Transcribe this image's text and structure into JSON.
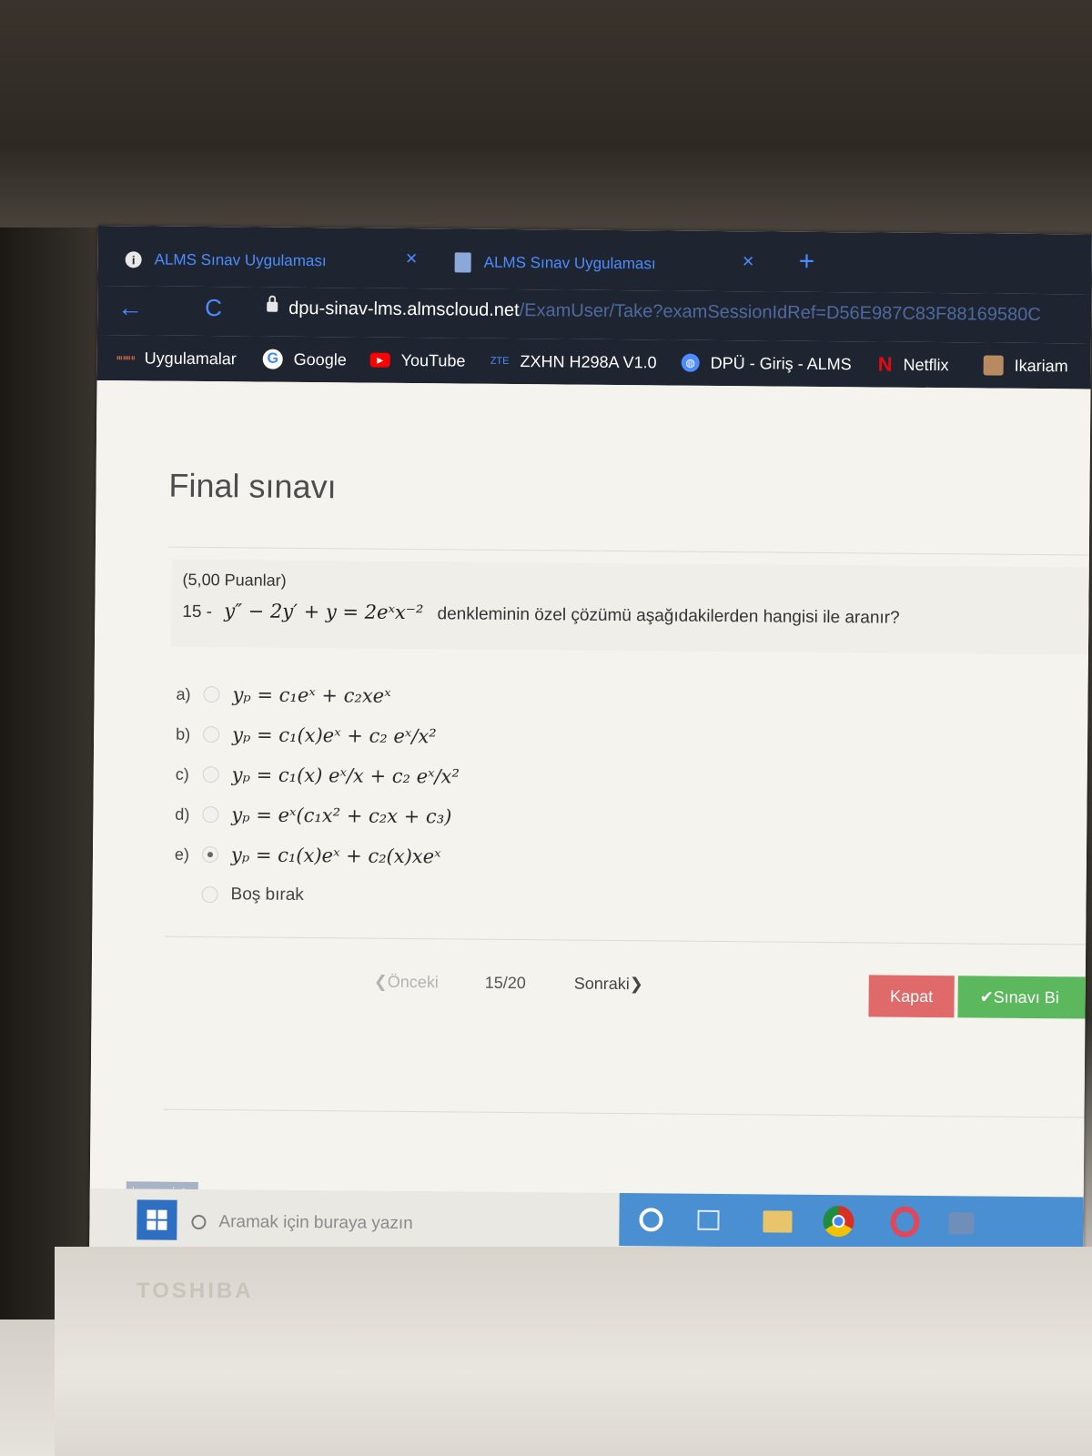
{
  "browser": {
    "tabs": [
      {
        "title": "ALMS Sınav Uygulaması",
        "icon": "info-icon"
      },
      {
        "title": "ALMS Sınav Uygulaması",
        "icon": "document-icon"
      }
    ],
    "close_glyph": "×",
    "new_tab_glyph": "+",
    "back_glyph": "←",
    "reload_glyph": "C",
    "url_host": "dpu-sinav-lms.almscloud.net",
    "url_path": "/ExamUser/Take?examSessionIdRef=D56E987C83F88169580C",
    "bookmarks": [
      {
        "label": "Uygulamalar",
        "icon": "apps-icon"
      },
      {
        "label": "Google",
        "icon": "google-icon"
      },
      {
        "label": "YouTube",
        "icon": "youtube-icon"
      },
      {
        "label": "ZXHN H298A V1.0",
        "icon": "zte-icon",
        "icon_text": "ZTE"
      },
      {
        "label": "DPÜ - Giriş - ALMS",
        "icon": "globe-icon"
      },
      {
        "label": "Netflix",
        "icon": "netflix-icon",
        "icon_text": "N"
      },
      {
        "label": "Ikariam",
        "icon": "ikariam-icon"
      }
    ]
  },
  "exam": {
    "title": "Final sınavı",
    "points": "(5,00 Puanlar)",
    "question_number": "15 -",
    "question_equation": "y″ − 2y′ + y = 2eˣx⁻²",
    "question_text": "denkleminin özel çözümü aşağıdakilerden hangisi ile aranır?",
    "options": [
      {
        "letter": "a)",
        "text": "yₚ = c₁eˣ + c₂xeˣ",
        "checked": false
      },
      {
        "letter": "b)",
        "text": "yₚ = c₁(x)eˣ + c₂ eˣ/x²",
        "checked": false
      },
      {
        "letter": "c)",
        "text": "yₚ = c₁(x) eˣ/x + c₂ eˣ/x²",
        "checked": false
      },
      {
        "letter": "d)",
        "text": "yₚ = eˣ(c₁x² + c₂x + c₃)",
        "checked": false
      },
      {
        "letter": "e)",
        "text": "yₚ = c₁(x)eˣ + c₂(x)xeˣ",
        "checked": true
      },
      {
        "letter": "",
        "text": "Boş bırak",
        "checked": false
      }
    ],
    "prev_label": "❮Önceki",
    "counter": "15/20",
    "next_label": "Sonraki❯",
    "close_button": "Kapat",
    "finish_button": "✔Sınavı Bi"
  },
  "status_text": "javascript:;",
  "taskbar": {
    "search_placeholder": "Aramak için buraya yazın"
  },
  "device_brand": "TOSHIBA",
  "colors": {
    "tab_text": "#4d8cff",
    "chrome_bg": "#1e2430",
    "close_button": "#e06a6a",
    "finish_button": "#5cb85c",
    "taskbar_tray": "#4a8fd1"
  }
}
